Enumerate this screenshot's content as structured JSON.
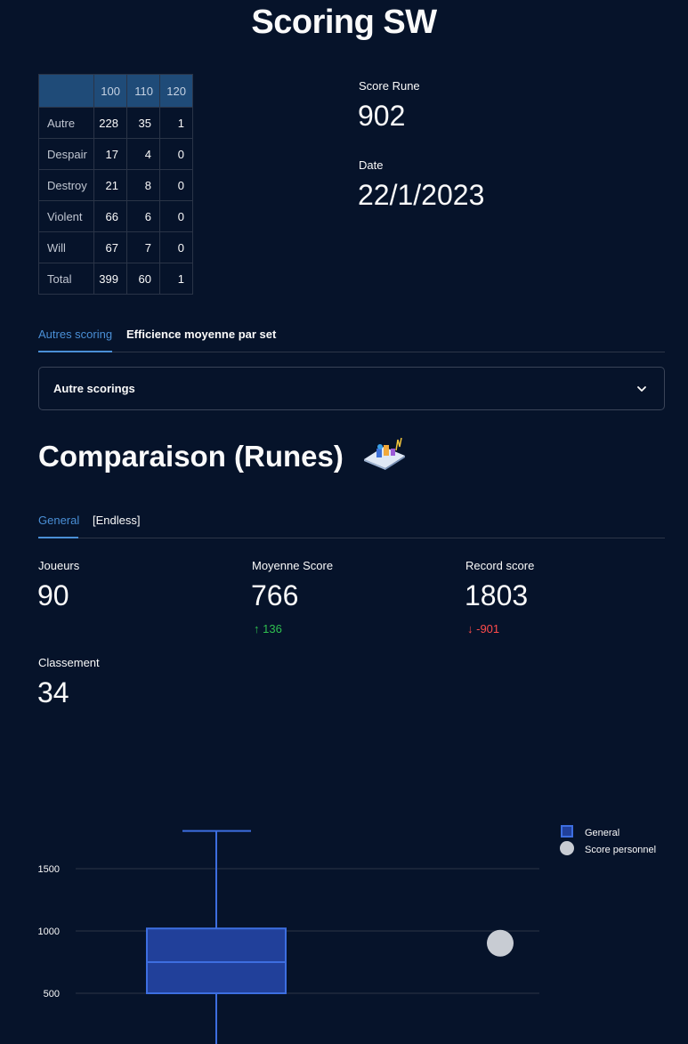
{
  "page": {
    "title": "Scoring SW"
  },
  "table": {
    "columns": [
      "100",
      "110",
      "120"
    ],
    "rows": [
      {
        "label": "Autre",
        "values": [
          "228",
          "35",
          "1"
        ]
      },
      {
        "label": "Despair",
        "values": [
          "17",
          "4",
          "0"
        ]
      },
      {
        "label": "Destroy",
        "values": [
          "21",
          "8",
          "0"
        ]
      },
      {
        "label": "Violent",
        "values": [
          "66",
          "6",
          "0"
        ]
      },
      {
        "label": "Will",
        "values": [
          "67",
          "7",
          "0"
        ]
      },
      {
        "label": "Total",
        "values": [
          "399",
          "60",
          "1"
        ]
      }
    ]
  },
  "summary": {
    "score_label": "Score Rune",
    "score_value": "902",
    "date_label": "Date",
    "date_value": "22/1/2023"
  },
  "tabs1": {
    "active": "Autres scoring",
    "other": "Efficience moyenne par set"
  },
  "expander": {
    "label": "Autre scorings"
  },
  "section": {
    "title": "Comparaison (Runes)"
  },
  "tabs2": {
    "active": "General",
    "other": "[Endless]"
  },
  "metrics": {
    "joueurs_label": "Joueurs",
    "joueurs_value": "90",
    "moyenne_label": "Moyenne Score",
    "moyenne_value": "766",
    "moyenne_delta": "136",
    "record_label": "Record score",
    "record_value": "1803",
    "record_delta": "-901",
    "classement_label": "Classement",
    "classement_value": "34"
  },
  "colors": {
    "accent": "#4a8fd6",
    "up": "#2fbf4f",
    "down": "#ff4b4b",
    "box_fill": "#21409a",
    "box_line": "#3d6ee0",
    "point": "#c8ccd3"
  },
  "chart_data": {
    "type": "box",
    "y_ticks": [
      500,
      1000,
      1500
    ],
    "series": [
      {
        "name": "General",
        "whisker_high": 1803,
        "q3": 1020,
        "median": 750,
        "q1": 500
      },
      {
        "name": "Score personnel",
        "value": 902
      }
    ],
    "legend": [
      "General",
      "Score personnel"
    ],
    "legend_position": "top-right"
  }
}
